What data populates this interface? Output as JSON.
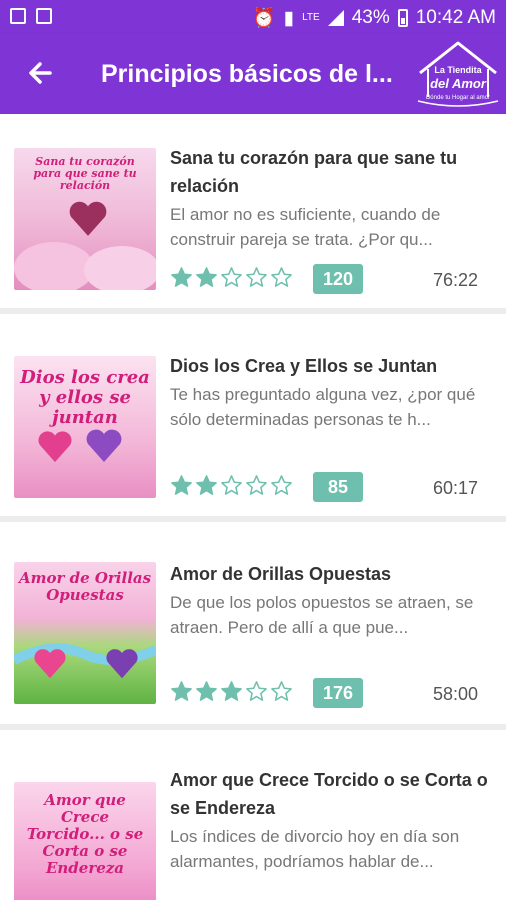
{
  "status_bar": {
    "network": "LTE",
    "battery": "43%",
    "time": "10:42 AM"
  },
  "app_bar": {
    "title": "Principios básicos de l...",
    "logo_line1": "La Tiendita",
    "logo_line2": "del Amor",
    "logo_tagline": "Dónde tu Hogar al amor",
    "back_icon": "arrow-back-icon"
  },
  "colors": {
    "primary": "#7f35d6",
    "badge": "#6ebfad",
    "star": "#6ebfad"
  },
  "items": [
    {
      "title": "Sana tu corazón para que sane tu relación",
      "description": "El amor no es suficiente, cuando de construir pareja se trata. ¿Por qu...",
      "rating": 2,
      "max_rating": 5,
      "count": "120",
      "duration": "76:22",
      "thumb_title": "Sana tu corazón para que sane tu relación"
    },
    {
      "title": "Dios los Crea y Ellos se Juntan",
      "description": "Te has preguntado alguna vez, ¿por qué sólo determinadas personas te h...",
      "rating": 2,
      "max_rating": 5,
      "count": "85",
      "duration": "60:17",
      "thumb_title": "Dios los crea y ellos se juntan"
    },
    {
      "title": "Amor de Orillas Opuestas",
      "description": "De que los polos opuestos se atraen, se atraen. Pero de allí a que pue...",
      "rating": 3,
      "max_rating": 5,
      "count": "176",
      "duration": "58:00",
      "thumb_title": "Amor de Orillas Opuestas"
    },
    {
      "title": "Amor que Crece Torcido o se Corta o se Endereza",
      "description": "Los índices de divorcio hoy en día son alarmantes, podríamos hablar de...",
      "thumb_title": "Amor que Crece Torcido... o se Corta o se Endereza"
    }
  ]
}
